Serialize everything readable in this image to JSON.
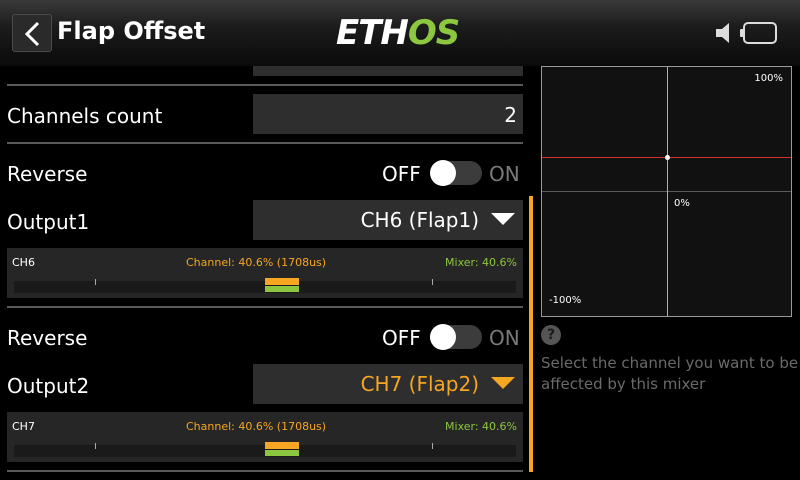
{
  "header": {
    "title": "Flap Offset",
    "logo_left": "ETH",
    "logo_right": "OS"
  },
  "rows": {
    "channels_count": {
      "label": "Channels count",
      "value": "2"
    },
    "reverse1": {
      "label": "Reverse",
      "off": "OFF",
      "on": "ON",
      "state": "off"
    },
    "output1": {
      "label": "Output1",
      "value": "CH6 (Flap1)"
    },
    "monitor1": {
      "ch": "CH6",
      "channel": "Channel: 40.6% (1708us)",
      "mixer": "Mixer: 40.6%",
      "channel_pct": 40.6,
      "mixer_pct": 40.6
    },
    "reverse2": {
      "label": "Reverse",
      "off": "OFF",
      "on": "ON",
      "state": "off"
    },
    "output2": {
      "label": "Output2",
      "value": "CH7 (Flap2)"
    },
    "monitor2": {
      "ch": "CH7",
      "channel": "Channel: 40.6% (1708us)",
      "mixer": "Mixer: 40.6%",
      "channel_pct": 40.6,
      "mixer_pct": 40.6
    }
  },
  "graph": {
    "top_label": "100%",
    "mid_label": "0%",
    "bottom_label": "-100%"
  },
  "help": {
    "icon": "?",
    "text": "Select the channel you want to be affected by this mixer"
  },
  "colors": {
    "accent_orange": "#f5a623",
    "accent_green": "#8dc63f",
    "curve_red": "#d0312d"
  }
}
